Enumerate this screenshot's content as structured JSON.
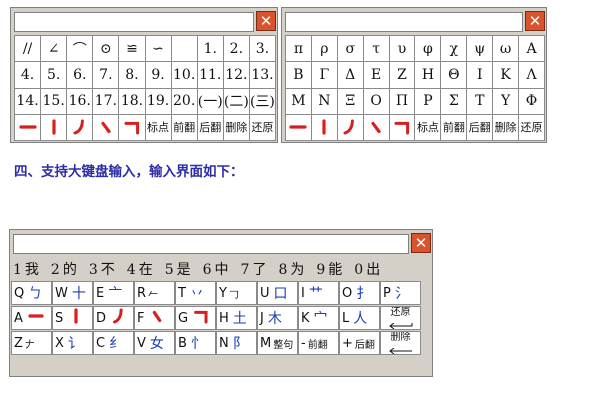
{
  "window_a": {
    "close_symbol": "✕",
    "rows": [
      [
        "//",
        "∠",
        "⌒",
        "⊙",
        "≌",
        "∽",
        "",
        "1.",
        "2.",
        "3."
      ],
      [
        "4.",
        "5.",
        "6.",
        "7.",
        "8.",
        "9.",
        "10.",
        "11.",
        "12.",
        "13."
      ],
      [
        "14.",
        "15.",
        "16.",
        "17.",
        "18.",
        "19.",
        "20.",
        "(一)",
        "(二)",
        "(三)"
      ]
    ],
    "stroke_row": [
      "stroke-heng",
      "stroke-shu",
      "stroke-pie",
      "stroke-dian",
      "stroke-zhe"
    ],
    "buttons": [
      "标点",
      "前翻",
      "后翻",
      "删除",
      "还原"
    ]
  },
  "window_b": {
    "close_symbol": "✕",
    "rows": [
      [
        "π",
        "ρ",
        "σ",
        "τ",
        "υ",
        "φ",
        "χ",
        "ψ",
        "ω",
        "Α"
      ],
      [
        "Β",
        "Γ",
        "Δ",
        "Ε",
        "Ζ",
        "Η",
        "Θ",
        "Ι",
        "Κ",
        "Λ"
      ],
      [
        "Μ",
        "Ν",
        "Ξ",
        "Ο",
        "Π",
        "Ρ",
        "Σ",
        "Τ",
        "Υ",
        "Φ"
      ]
    ],
    "stroke_row": [
      "stroke-heng",
      "stroke-shu",
      "stroke-pie",
      "stroke-dian",
      "stroke-zhe"
    ],
    "buttons": [
      "标点",
      "前翻",
      "后翻",
      "删除",
      "还原"
    ]
  },
  "caption": "四、支持大键盘输入，输入界面如下：",
  "keyboard": {
    "close_symbol": "✕",
    "candidates": [
      {
        "n": "1",
        "c": "我"
      },
      {
        "n": "2",
        "c": "的"
      },
      {
        "n": "3",
        "c": "不"
      },
      {
        "n": "4",
        "c": "在"
      },
      {
        "n": "5",
        "c": "是"
      },
      {
        "n": "6",
        "c": "中"
      },
      {
        "n": "7",
        "c": "了"
      },
      {
        "n": "8",
        "c": "为"
      },
      {
        "n": "9",
        "c": "能"
      },
      {
        "n": "0",
        "c": "出"
      }
    ],
    "row1": [
      {
        "l": "Q",
        "r": "ㄅ"
      },
      {
        "l": "W",
        "r": "十"
      },
      {
        "l": "E",
        "r": "亠"
      },
      {
        "l": "R",
        "r": "𠂉"
      },
      {
        "l": "T",
        "r": "丷"
      },
      {
        "l": "Y",
        "r": "𠃌"
      },
      {
        "l": "U",
        "r": "口"
      },
      {
        "l": "I",
        "r": "艹"
      },
      {
        "l": "O",
        "r": "扌"
      },
      {
        "l": "P",
        "r": "氵"
      }
    ],
    "row2": [
      {
        "l": "A",
        "r": "stroke-heng"
      },
      {
        "l": "S",
        "r": "stroke-shu"
      },
      {
        "l": "D",
        "r": "stroke-pie"
      },
      {
        "l": "F",
        "r": "stroke-dian"
      },
      {
        "l": "G",
        "r": "stroke-zhe"
      },
      {
        "l": "H",
        "r": "土"
      },
      {
        "l": "J",
        "r": "木"
      },
      {
        "l": "K",
        "r": "宀"
      },
      {
        "l": "L",
        "r": "人"
      }
    ],
    "restore": "还原",
    "row3": [
      {
        "l": "Z",
        "r": "𠂇"
      },
      {
        "l": "X",
        "r": "讠"
      },
      {
        "l": "C",
        "r": "纟"
      },
      {
        "l": "V",
        "r": "女"
      },
      {
        "l": "B",
        "r": "忄"
      },
      {
        "l": "N",
        "r": "阝"
      },
      {
        "l": "M",
        "r": "整句"
      },
      {
        "l": "-",
        "r": "前翻"
      },
      {
        "l": "+",
        "r": "后翻"
      }
    ],
    "delete": "删除"
  },
  "colors": {
    "stroke_red": "#d81e1e",
    "radical_blue": "#1a3fb0",
    "caption": "#2c2ca8",
    "close": "#d9532c"
  }
}
